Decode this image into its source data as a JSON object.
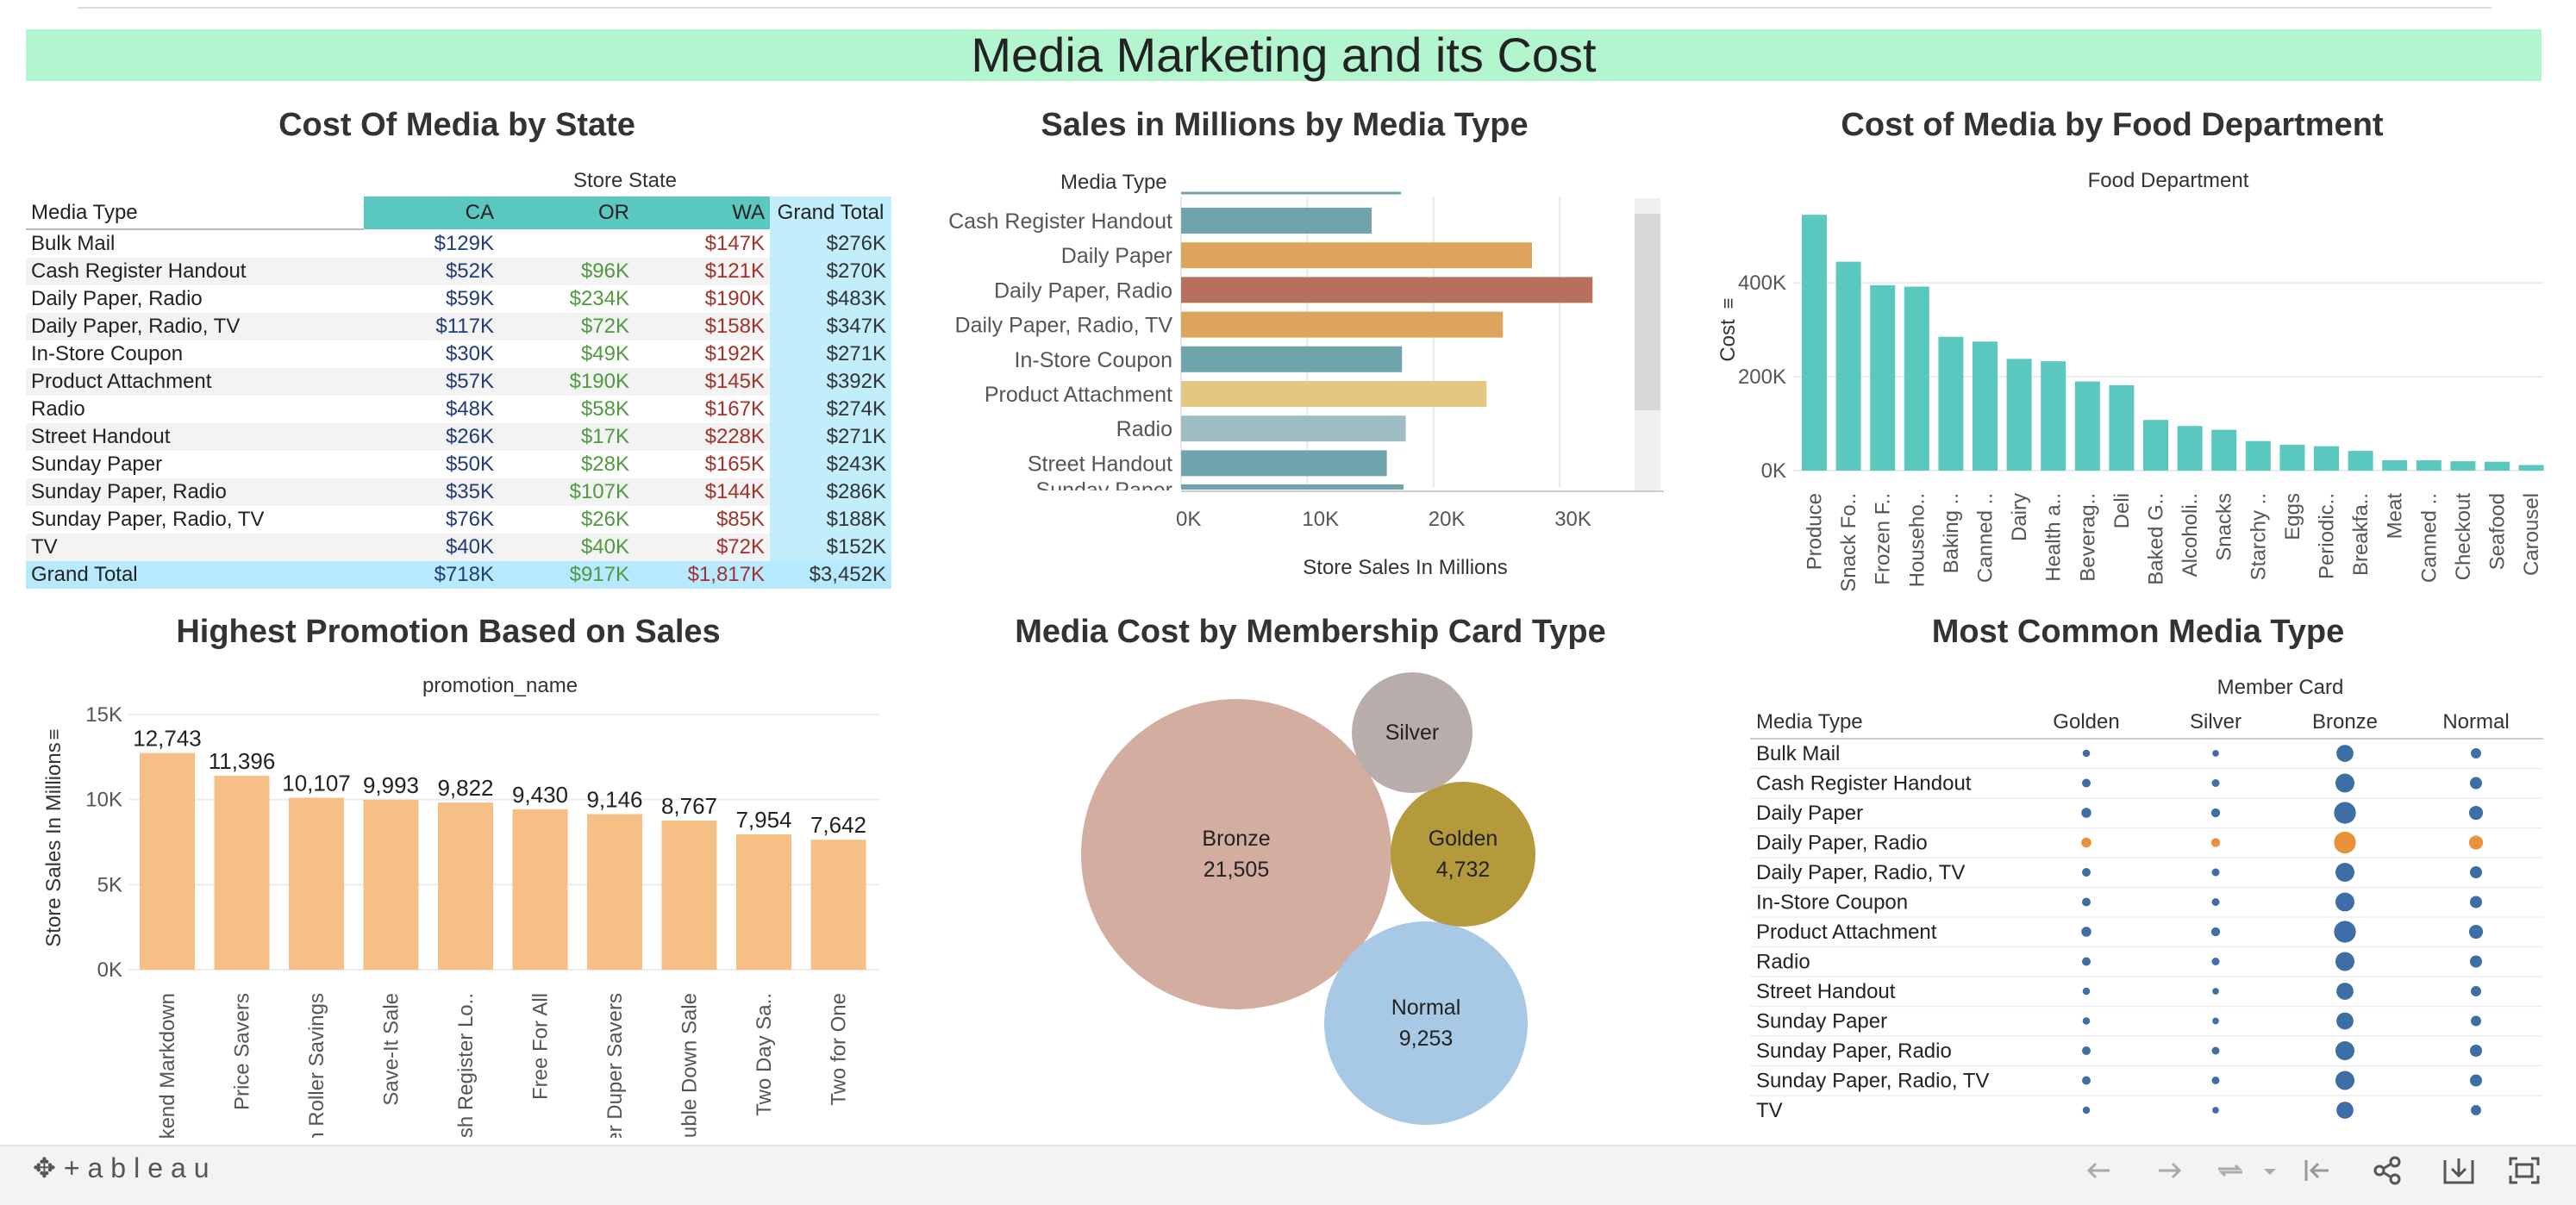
{
  "dashboard": {
    "title": "Media Marketing and its Cost"
  },
  "crosstab": {
    "title": "Cost Of Media by State",
    "column_group": "Store State",
    "row_header": "Media Type",
    "columns": [
      "CA",
      "OR",
      "WA",
      "Grand Total"
    ],
    "rows": [
      {
        "label": "Bulk Mail",
        "values": [
          "$129K",
          "",
          "$147K",
          "$276K"
        ]
      },
      {
        "label": "Cash Register Handout",
        "values": [
          "$52K",
          "$96K",
          "$121K",
          "$270K"
        ]
      },
      {
        "label": "Daily Paper, Radio",
        "values": [
          "$59K",
          "$234K",
          "$190K",
          "$483K"
        ]
      },
      {
        "label": "Daily Paper, Radio, TV",
        "values": [
          "$117K",
          "$72K",
          "$158K",
          "$347K"
        ]
      },
      {
        "label": "In-Store Coupon",
        "values": [
          "$30K",
          "$49K",
          "$192K",
          "$271K"
        ]
      },
      {
        "label": "Product Attachment",
        "values": [
          "$57K",
          "$190K",
          "$145K",
          "$392K"
        ]
      },
      {
        "label": "Radio",
        "values": [
          "$48K",
          "$58K",
          "$167K",
          "$274K"
        ]
      },
      {
        "label": "Street Handout",
        "values": [
          "$26K",
          "$17K",
          "$228K",
          "$271K"
        ]
      },
      {
        "label": "Sunday Paper",
        "values": [
          "$50K",
          "$28K",
          "$165K",
          "$243K"
        ]
      },
      {
        "label": "Sunday Paper, Radio",
        "values": [
          "$35K",
          "$107K",
          "$144K",
          "$286K"
        ]
      },
      {
        "label": "Sunday Paper, Radio, TV",
        "values": [
          "$76K",
          "$26K",
          "$85K",
          "$188K"
        ]
      },
      {
        "label": "TV",
        "values": [
          "$40K",
          "$40K",
          "$72K",
          "$152K"
        ]
      }
    ],
    "total": {
      "label": "Grand Total",
      "values": [
        "$718K",
        "$917K",
        "$1,817K",
        "$3,452K"
      ]
    },
    "colors": {
      "header": "#5bc8c0",
      "total_col": "#c2eefc",
      "total_row": "#b8eaff",
      "CA": "#1f3d7a",
      "OR": "#4f9a3e",
      "WA": "#a3322c"
    }
  },
  "sales_media": {
    "title": "Sales in Millions by Media Type",
    "row_header": "Media Type",
    "cut_label": "Sunday Paper",
    "chart_data": {
      "type": "bar",
      "categories": [
        "Cash Register Handout",
        "Daily Paper",
        "Daily Paper, Radio",
        "Daily Paper, Radio, TV",
        "In-Store Coupon",
        "Product Attachment",
        "Radio",
        "Street Handout"
      ],
      "values": [
        15100,
        27800,
        32600,
        25500,
        17500,
        24200,
        17800,
        16300
      ],
      "colors": [
        "#6ea4aa",
        "#dda45e",
        "#b6705c",
        "#dda45e",
        "#6ea4aa",
        "#e6c683",
        "#9dbdc3",
        "#6ea4aa"
      ],
      "xlabel": "Store Sales In Millions",
      "xticks": [
        "0K",
        "10K",
        "20K",
        "30K"
      ],
      "xlim": [
        0,
        35000
      ]
    }
  },
  "food_dept": {
    "title": "Cost of Media by Food Department",
    "header": "Food Department",
    "chart_data": {
      "type": "bar",
      "categories": [
        "Produce",
        "Snack Fo..",
        "Frozen F..",
        "Househo..",
        "Baking ..",
        "Canned ..",
        "Dairy",
        "Health a..",
        "Beverag..",
        "Deli",
        "Baked G..",
        "Alcoholi..",
        "Snacks",
        "Starchy ..",
        "Eggs",
        "Periodic..",
        "Breakfa..",
        "Meat",
        "Canned ..",
        "Checkout",
        "Seafood",
        "Carousel"
      ],
      "values": [
        545000,
        445000,
        395000,
        392000,
        285000,
        275000,
        238000,
        233000,
        190000,
        182000,
        108000,
        95000,
        87000,
        63000,
        55000,
        52000,
        42000,
        22000,
        22000,
        20000,
        19000,
        12000
      ],
      "ylabel": "Cost",
      "yticks": [
        "0K",
        "200K",
        "400K"
      ],
      "ylim": [
        0,
        560000
      ],
      "color": "#5bc8c0"
    }
  },
  "promotion": {
    "title": "Highest Promotion Based on Sales",
    "header": "promotion_name",
    "chart_data": {
      "type": "bar",
      "categories": [
        "Weekend Markdown",
        "Price Savers",
        "High Roller Savings",
        "Save-It Sale",
        "Cash Register Lo..",
        "Free For All",
        "Super Duper Savers",
        "Double Down Sale",
        "Two Day Sa..",
        "Two for One"
      ],
      "values": [
        12743,
        11396,
        10107,
        9993,
        9822,
        9430,
        9146,
        8767,
        7954,
        7642
      ],
      "labels": [
        "12,743",
        "11,396",
        "10,107",
        "9,993",
        "9,822",
        "9,430",
        "9,146",
        "8,767",
        "7,954",
        "7,642"
      ],
      "ylabel": "Store Sales In Millions",
      "yticks": [
        "0K",
        "5K",
        "10K",
        "15K"
      ],
      "ylim": [
        0,
        15000
      ],
      "color": "#f5bf86"
    }
  },
  "membership": {
    "title": "Media Cost by Membership Card Type",
    "chart_data": {
      "type": "bubble",
      "items": [
        {
          "name": "Bronze",
          "value": 21505,
          "label": "21,505",
          "color": "#d2ada0"
        },
        {
          "name": "Normal",
          "value": 9253,
          "label": "9,253",
          "color": "#a8c9e6"
        },
        {
          "name": "Golden",
          "value": 4732,
          "label": "4,732",
          "color": "#b49a3a"
        },
        {
          "name": "Silver",
          "value": null,
          "label": "",
          "color": "#b8adab"
        }
      ]
    }
  },
  "common_media": {
    "title": "Most Common Media Type",
    "column_group": "Member Card",
    "row_header": "Media Type",
    "columns": [
      "Golden",
      "Silver",
      "Bronze",
      "Normal"
    ],
    "rows": [
      "Bulk Mail",
      "Cash Register Handout",
      "Daily Paper",
      "Daily Paper, Radio",
      "Daily Paper, Radio, TV",
      "In-Store Coupon",
      "Product Attachment",
      "Radio",
      "Street Handout",
      "Sunday Paper",
      "Sunday Paper, Radio",
      "Sunday Paper, Radio, TV",
      "TV"
    ],
    "highlight_row": "Daily Paper, Radio",
    "colors": {
      "dot": "#3e6ea6",
      "highlight": "#e8913a"
    }
  },
  "footer": {
    "logo": "+ableau"
  }
}
